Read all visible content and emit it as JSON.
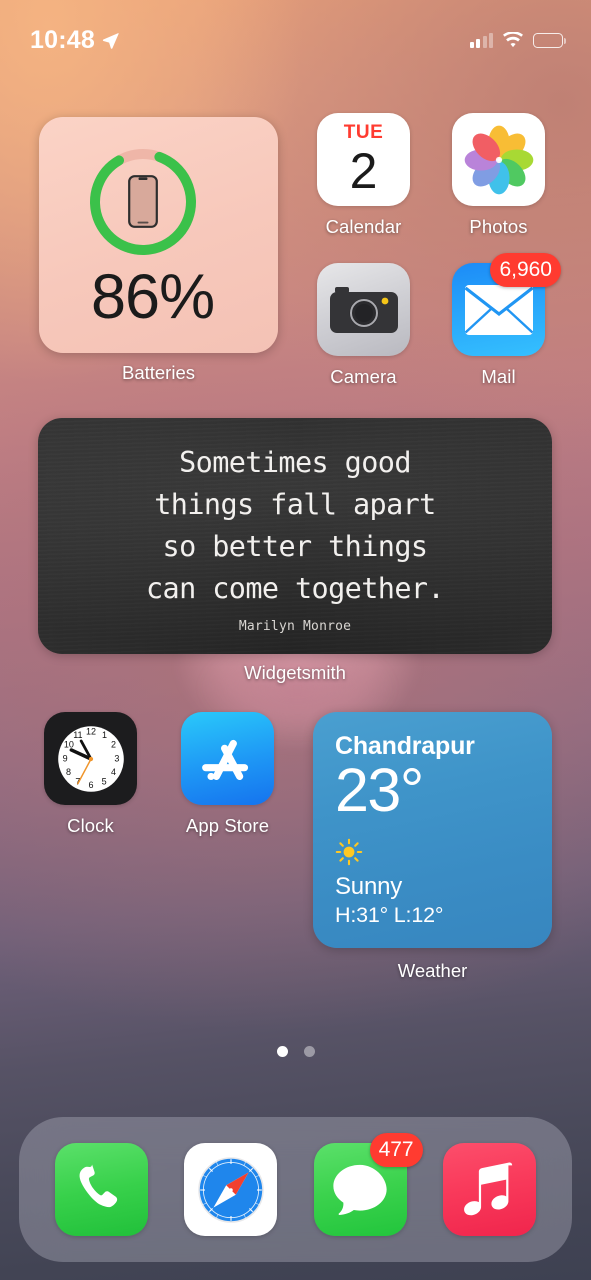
{
  "status_bar": {
    "time": "10:48",
    "location_icon": "location-arrow-icon",
    "cellular_icon": "cellular-signal-icon",
    "cellular_bars": 2,
    "wifi_icon": "wifi-icon",
    "battery_icon": "battery-icon",
    "battery_level_pct": 86
  },
  "widgets": {
    "batteries": {
      "label": "Batteries",
      "percent_text": "86%",
      "percent_value": 86,
      "device_icon": "iphone-icon",
      "ring_color": "#3BC14A",
      "background_color": "#F7C8BB"
    },
    "quote": {
      "label": "Widgetsmith",
      "lines": [
        "Sometimes good",
        "things fall apart",
        "so better things",
        "can come together."
      ],
      "author": "Marilyn Monroe",
      "background_color": "#303030"
    },
    "weather": {
      "label": "Weather",
      "city": "Chandrapur",
      "temperature": "23°",
      "condition": "Sunny",
      "high_low": "H:31° L:12°",
      "condition_icon": "sun-icon",
      "background_color": "#3F94C9"
    }
  },
  "apps": [
    {
      "name": "Calendar",
      "icon": "calendar-icon",
      "weekday": "TUE",
      "day": "2",
      "badge": null
    },
    {
      "name": "Photos",
      "icon": "photos-icon",
      "badge": null
    },
    {
      "name": "Camera",
      "icon": "camera-icon",
      "badge": null
    },
    {
      "name": "Mail",
      "icon": "mail-icon",
      "badge": "6,960"
    },
    {
      "name": "Clock",
      "icon": "clock-icon",
      "badge": null
    },
    {
      "name": "App Store",
      "icon": "app-store-icon",
      "badge": null
    }
  ],
  "page_indicator": {
    "total": 2,
    "current": 1
  },
  "dock": [
    {
      "name": "Phone",
      "icon": "phone-icon",
      "badge": null
    },
    {
      "name": "Safari",
      "icon": "safari-icon",
      "badge": null
    },
    {
      "name": "Messages",
      "icon": "messages-icon",
      "badge": "477"
    },
    {
      "name": "Music",
      "icon": "music-icon",
      "badge": null
    }
  ],
  "colors": {
    "badge_red": "#FF3B30",
    "accent_green": "#3BC14A",
    "wallpaper_top": "#E9A179",
    "wallpaper_bottom": "#3E4152"
  }
}
